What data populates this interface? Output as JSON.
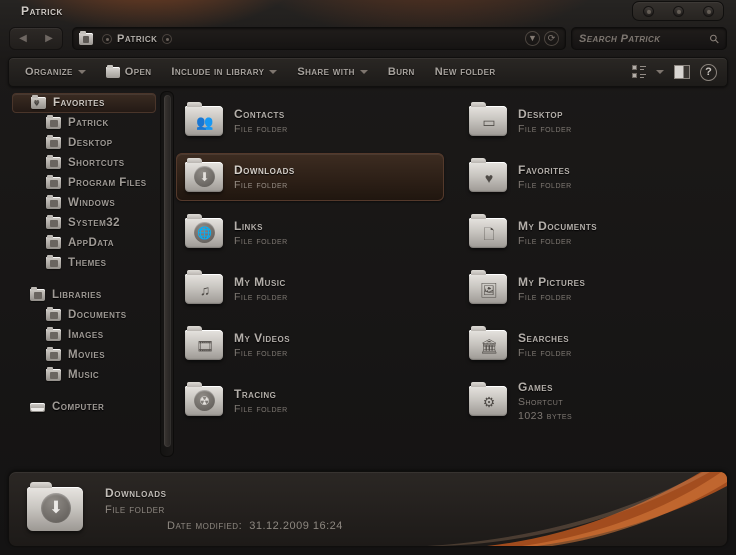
{
  "window": {
    "title": "Patrick",
    "controls": [
      "minimize-button",
      "maximize-button",
      "close-button"
    ]
  },
  "nav": {
    "back_label": "◀",
    "forward_label": "▶",
    "breadcrumb": "Patrick",
    "dropdown_icon": "▼",
    "refresh_icon": "⟳"
  },
  "search": {
    "placeholder": "Search Patrick",
    "icon": "search-icon"
  },
  "toolbar": {
    "organize": "Organize",
    "open": "Open",
    "include_in_library": "Include in library",
    "share_with": "Share with",
    "burn": "Burn",
    "new_folder": "New folder",
    "view_options": "view-options-icon",
    "preview_pane": "preview-pane-icon",
    "help": "?"
  },
  "sidebar": {
    "groups": [
      {
        "header": "Favorites",
        "selected": true,
        "items": [
          {
            "label": "Patrick"
          },
          {
            "label": "Desktop"
          },
          {
            "label": "Shortcuts"
          },
          {
            "label": "Program Files"
          },
          {
            "label": "Windows"
          },
          {
            "label": "System32"
          },
          {
            "label": "AppData"
          },
          {
            "label": "Themes"
          }
        ]
      },
      {
        "header": "Libraries",
        "selected": false,
        "items": [
          {
            "label": "Documents"
          },
          {
            "label": "Images"
          },
          {
            "label": "Movies"
          },
          {
            "label": "Music"
          }
        ]
      },
      {
        "header": "Computer",
        "selected": false,
        "items": []
      }
    ]
  },
  "files": [
    {
      "name": "Contacts",
      "type": "File folder",
      "size": "",
      "glyph": "👥",
      "style": "flat",
      "selected": false
    },
    {
      "name": "Desktop",
      "type": "File folder",
      "size": "",
      "glyph": "▭",
      "style": "flat",
      "selected": false
    },
    {
      "name": "Downloads",
      "type": "File folder",
      "size": "",
      "glyph": "⬇",
      "style": "circle",
      "selected": true
    },
    {
      "name": "Favorites",
      "type": "File folder",
      "size": "",
      "glyph": "♥",
      "style": "flat",
      "selected": false
    },
    {
      "name": "Links",
      "type": "File folder",
      "size": "",
      "glyph": "🌐",
      "style": "circle",
      "selected": false
    },
    {
      "name": "My Documents",
      "type": "File folder",
      "size": "",
      "glyph": "🗋",
      "style": "flat",
      "selected": false
    },
    {
      "name": "My Music",
      "type": "File folder",
      "size": "",
      "glyph": "♫",
      "style": "flat",
      "selected": false
    },
    {
      "name": "My Pictures",
      "type": "File folder",
      "size": "",
      "glyph": "🖼",
      "style": "flat",
      "selected": false
    },
    {
      "name": "My Videos",
      "type": "File folder",
      "size": "",
      "glyph": "🎞",
      "style": "flat",
      "selected": false
    },
    {
      "name": "Searches",
      "type": "File folder",
      "size": "",
      "glyph": "🏛",
      "style": "flat",
      "selected": false
    },
    {
      "name": "Tracing",
      "type": "File folder",
      "size": "",
      "glyph": "☢",
      "style": "circle",
      "selected": false
    },
    {
      "name": "Games",
      "type": "Shortcut",
      "size": "1023 bytes",
      "glyph": "⚙",
      "style": "flat",
      "selected": false
    }
  ],
  "details": {
    "name": "Downloads",
    "type": "File folder",
    "date_modified_label": "Date modified:",
    "date_modified_value": "31.12.2009 16:24",
    "icon": "download-folder-icon"
  },
  "colors": {
    "accent_orange": "#c4622a",
    "selection_brown": "#3d2c21",
    "window_bg": "#1a1818",
    "text": "#b9b4b0"
  }
}
